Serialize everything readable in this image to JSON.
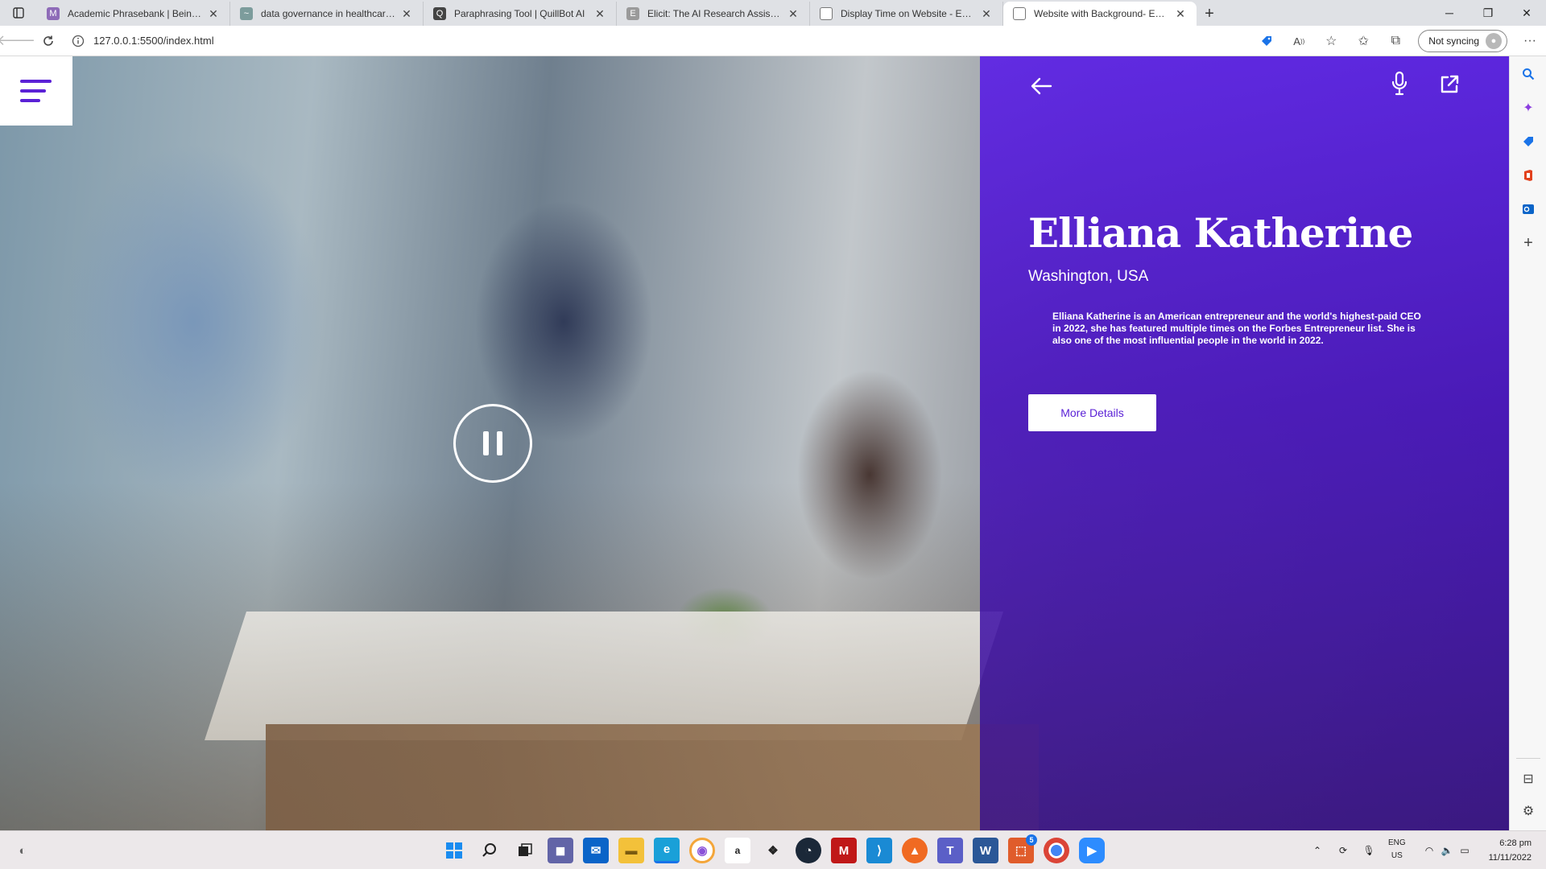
{
  "browser": {
    "tabs": [
      {
        "title": "Academic Phrasebank | Being ca",
        "favicon": "M",
        "favicon_color": "#8e6bb8"
      },
      {
        "title": "data governance in healthcare |",
        "favicon": "~",
        "favicon_color": "#7c9c9c"
      },
      {
        "title": "Paraphrasing Tool | QuillBot AI",
        "favicon": "Q",
        "favicon_color": "#444444"
      },
      {
        "title": "Elicit: The AI Research Assistant",
        "favicon": "E",
        "favicon_color": "#9a9a9a"
      },
      {
        "title": "Display Time on Website - Easy T",
        "favicon": "",
        "favicon_color": "#ffffff"
      },
      {
        "title": "Website with Background- Easy T",
        "favicon": "",
        "favicon_color": "#ffffff",
        "active": true
      }
    ],
    "url": "127.0.0.1:5500/index.html",
    "sync_label": "Not syncing",
    "icons": {
      "back": "arrow-left-icon",
      "refresh": "refresh-icon",
      "info": "info-icon",
      "extension": "tag-icon",
      "read_aloud": "read-aloud-icon",
      "favorite": "star-add-icon",
      "favorites": "favorites-icon",
      "collections": "collections-icon",
      "more": "more-icon"
    }
  },
  "page": {
    "profile": {
      "name": "Elliana Katherine",
      "location": "Washington, USA",
      "bio": "Elliana Katherine is an American entrepreneur and the world's highest-paid CEO in 2022, she has featured multiple times on the Forbes Entrepreneur list. She is also one of the most influential people in the world in 2022.",
      "button_label": "More Details"
    },
    "colors": {
      "accent": "#5b21d6",
      "panel": "#5c21e6"
    }
  },
  "taskbar": {
    "lang_top": "ENG",
    "lang_bottom": "US",
    "time": "6:28 pm",
    "date": "11/11/2022",
    "badge": "5"
  }
}
